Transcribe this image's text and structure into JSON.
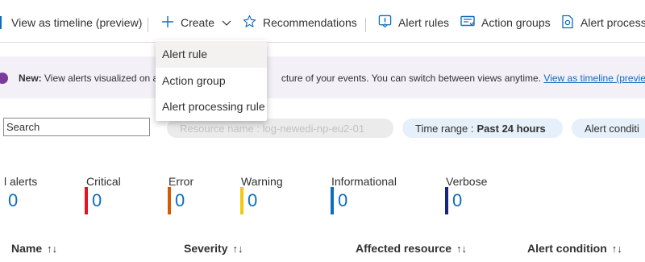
{
  "toolbar": {
    "view_timeline": "View as timeline (preview)",
    "create": "Create",
    "recommendations": "Recommendations",
    "alert_rules": "Alert rules",
    "action_groups": "Action groups",
    "alert_processing": "Alert process"
  },
  "create_menu": {
    "items": [
      "Alert rule",
      "Action group",
      "Alert processing rule"
    ]
  },
  "banner": {
    "new_label": "New:",
    "text_start": "View alerts visualized on a",
    "text_end": "cture of your events. You can switch between views anytime.",
    "link": "View as timeline (preview)"
  },
  "filters": {
    "search_placeholder": "Search",
    "resource_pill": "Resource name : log-newedi-np-eu2-01",
    "time_label": "Time range : ",
    "time_value": "Past 24 hours",
    "alert_condition": "Alert conditi"
  },
  "summary": [
    {
      "label": "l alerts",
      "value": "0",
      "color": "#ffffff"
    },
    {
      "label": "Critical",
      "value": "0",
      "color": "#e81123"
    },
    {
      "label": "Error",
      "value": "0",
      "color": "#d85a00"
    },
    {
      "label": "Warning",
      "value": "0",
      "color": "#f2c811"
    },
    {
      "label": "Informational",
      "value": "0",
      "color": "#0f6cbd"
    },
    {
      "label": "Verbose",
      "value": "0",
      "color": "#1a237e"
    }
  ],
  "columns": [
    "Name",
    "Severity",
    "Affected resource",
    "Alert condition"
  ],
  "sort_icon": "↑↓",
  "colors": {
    "accent": "#0f6cbd",
    "banner_bg": "#f4f0f8"
  }
}
